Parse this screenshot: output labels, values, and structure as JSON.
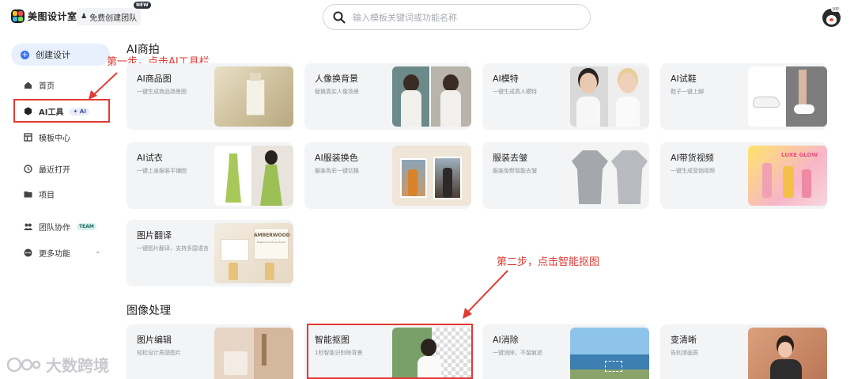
{
  "header": {
    "app_name": "美图设计室",
    "team_button": "免费创建团队",
    "new_badge": "NEW",
    "search_placeholder": "输入模板关键词或功能名称",
    "vip_badge": "VIP"
  },
  "sidebar": {
    "create": "创建设计",
    "items": [
      {
        "label": "首页",
        "icon": "home-icon"
      },
      {
        "label": "AI工具",
        "icon": "cube-icon",
        "badge": "✦ AI"
      },
      {
        "label": "模板中心",
        "icon": "template-icon"
      },
      {
        "label": "最近打开",
        "icon": "clock-icon"
      },
      {
        "label": "项目",
        "icon": "folder-icon"
      },
      {
        "label": "团队协作",
        "icon": "team-icon",
        "badge": "TEAM"
      },
      {
        "label": "更多功能",
        "icon": "more-icon"
      }
    ]
  },
  "annotations": {
    "step1": "第一步，点击AI工具栏",
    "step2": "第二步，点击智能抠图"
  },
  "sections": {
    "ai_product": "AI商拍",
    "image_processing": "图像处理"
  },
  "cards": {
    "ai_product_image": {
      "title": "AI商品图",
      "sub": "一键生成商品场景图"
    },
    "portrait_bg": {
      "title": "人像换背景",
      "sub": "替换真实人像场景"
    },
    "ai_model": {
      "title": "AI模特",
      "sub": "一键生成真人模特"
    },
    "ai_shoes": {
      "title": "AI试鞋",
      "sub": "鞋子一键上脚"
    },
    "ai_tryon": {
      "title": "AI试衣",
      "sub": "一键上身服装平铺图"
    },
    "ai_color": {
      "title": "AI服装换色",
      "sub": "服装色彩一键切换"
    },
    "wrinkle": {
      "title": "服装去皱",
      "sub": "服装免熨智能去皱"
    },
    "ai_video": {
      "title": "AI带货视频",
      "sub": "一键生成营销视频"
    },
    "translate": {
      "title": "图片翻译",
      "sub": "一键图片翻译，支持多国语言"
    },
    "edit": {
      "title": "图片编辑",
      "sub": "轻松设计质感图片"
    },
    "cutout": {
      "title": "智能抠图",
      "sub": "1秒智能识别除背景"
    },
    "erase": {
      "title": "AI消除",
      "sub": "一键消除，不留痕迹"
    },
    "sharpen": {
      "title": "变清晰",
      "sub": "告别渣画质"
    }
  },
  "thumb_text": {
    "perfume_brand": "AMBERWOOD",
    "perfume_sub": "Elegance in Every Scent",
    "poster_text": "LUXE GLOW"
  },
  "watermark": "大数跨境",
  "colors": {
    "accent": "#3574f0",
    "annotation": "#e23a35",
    "card_bg": "#f3f4f6"
  }
}
